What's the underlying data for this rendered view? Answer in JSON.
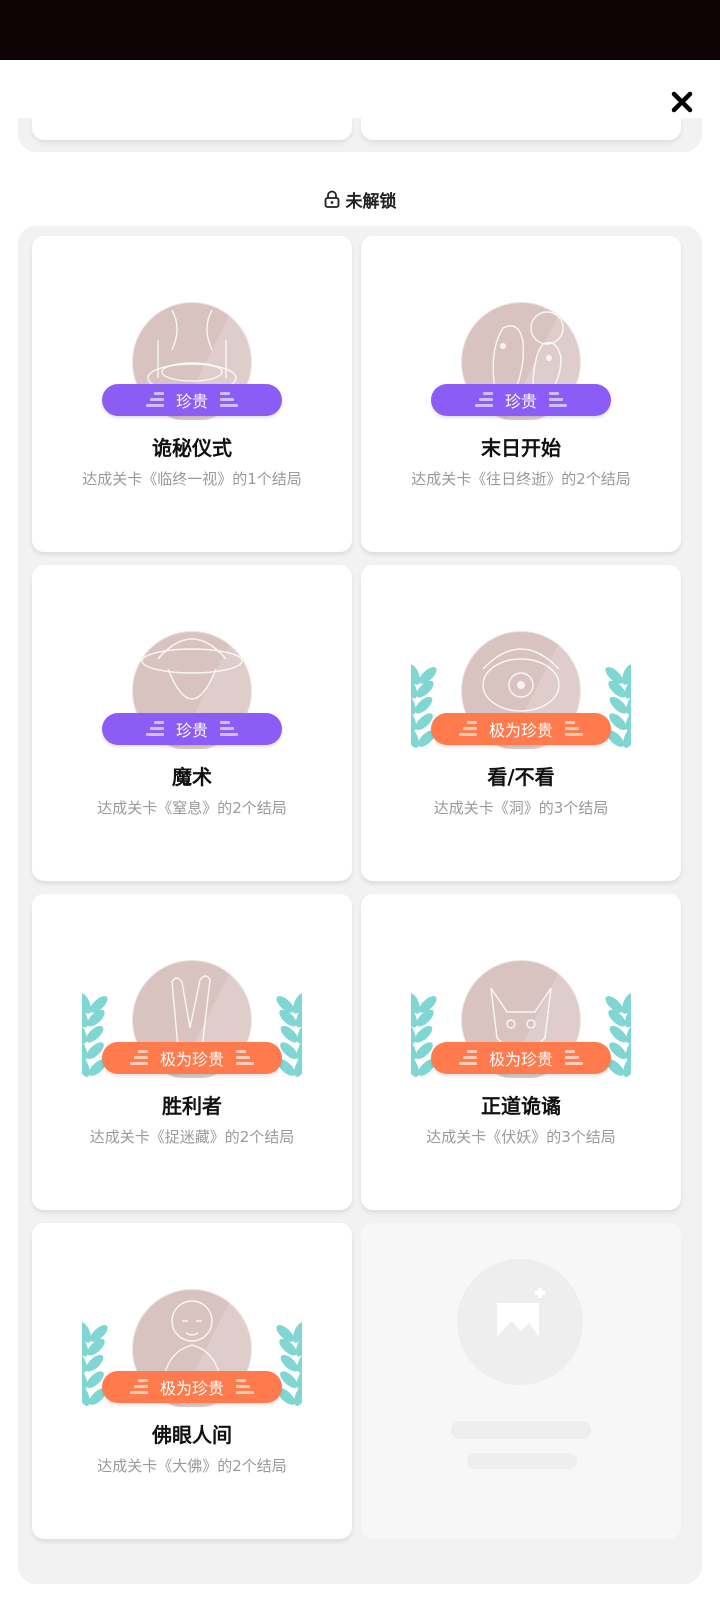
{
  "colors": {
    "status_bar": "#0d0304",
    "rare_tag": "#8b5cf6",
    "very_rare_tag": "#ff7a4d",
    "laurel": "#7fd6d3",
    "badge_circle": "#d8c3c1"
  },
  "section": {
    "lock_icon": "lock-icon",
    "title": "未解锁"
  },
  "cards": [
    {
      "title": "诡秘仪式",
      "desc": "达成关卡《临终一视》的1个结局",
      "rarity": "珍贵",
      "tier": "rare",
      "laurel": false,
      "art": "ritual"
    },
    {
      "title": "末日开始",
      "desc": "达成关卡《往日终逝》的2个结局",
      "rarity": "珍贵",
      "tier": "rare",
      "laurel": false,
      "art": "doom"
    },
    {
      "title": "魔术",
      "desc": "达成关卡《窒息》的2个结局",
      "rarity": "珍贵",
      "tier": "rare",
      "laurel": false,
      "art": "magician"
    },
    {
      "title": "看/不看",
      "desc": "达成关卡《洞》的3个结局",
      "rarity": "极为珍贵",
      "tier": "very_rare",
      "laurel": true,
      "art": "eye"
    },
    {
      "title": "胜利者",
      "desc": "达成关卡《捉迷藏》的2个结局",
      "rarity": "极为珍贵",
      "tier": "very_rare",
      "laurel": true,
      "art": "victory"
    },
    {
      "title": "正道诡谲",
      "desc": "达成关卡《伏妖》的3个结局",
      "rarity": "极为珍贵",
      "tier": "very_rare",
      "laurel": true,
      "art": "fox"
    },
    {
      "title": "佛眼人间",
      "desc": "达成关卡《大佛》的2个结局",
      "rarity": "极为珍贵",
      "tier": "very_rare",
      "laurel": true,
      "art": "buddha"
    }
  ]
}
